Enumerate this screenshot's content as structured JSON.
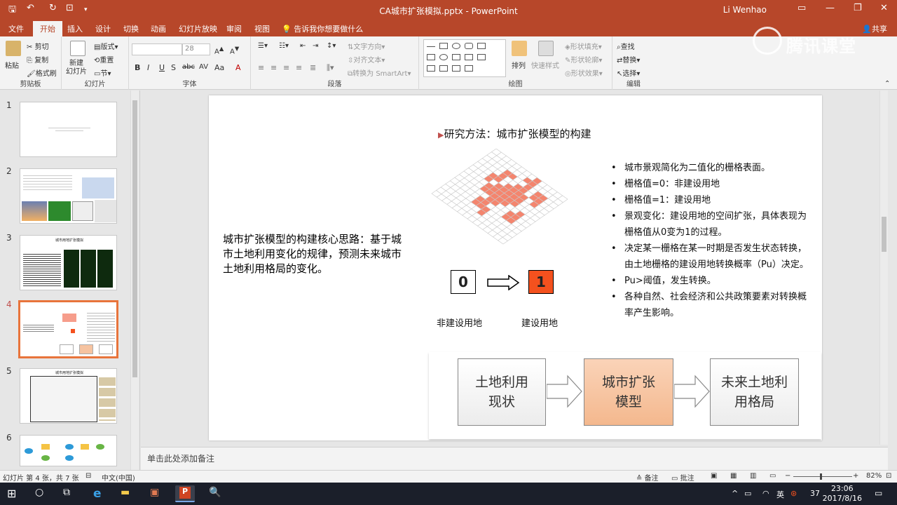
{
  "window": {
    "title": "CA城市扩张模拟.pptx - PowerPoint",
    "user": "Li Wenhao",
    "minimize": "—",
    "restore": "❐",
    "close": "✕"
  },
  "tabs": [
    "文件",
    "开始",
    "插入",
    "设计",
    "切换",
    "动画",
    "幻灯片放映",
    "审阅",
    "视图"
  ],
  "tell_me": "告诉我你想要做什么",
  "share": "共享",
  "watermark": "腾讯课堂",
  "ribbon": {
    "clipboard": {
      "label": "剪贴板",
      "paste": "粘贴",
      "cut": "剪切",
      "copy": "复制",
      "format_painter": "格式刷"
    },
    "slides": {
      "label": "幻灯片",
      "new_slide": "新建\n幻灯片",
      "layout": "版式",
      "reset": "重置",
      "section": "节"
    },
    "font": {
      "label": "字体",
      "font_size": "28",
      "bold": "B",
      "italic": "I",
      "underline": "U",
      "strike": "S",
      "abc": "abc",
      "spacing": "AV",
      "case": "Aa",
      "clear": "A",
      "color": "A"
    },
    "paragraph": {
      "label": "段落",
      "text_direction": "文字方向",
      "align_text": "对齐文本",
      "smartart": "转换为 SmartArt"
    },
    "drawing": {
      "label": "绘图",
      "arrange": "排列",
      "quick_styles": "快速样式",
      "shape_fill": "形状填充",
      "shape_outline": "形状轮廓",
      "shape_effects": "形状效果"
    },
    "editing": {
      "label": "编辑",
      "find": "查找",
      "replace": "替换",
      "select": "选择"
    }
  },
  "thumbnails": [
    {
      "num": "1"
    },
    {
      "num": "2"
    },
    {
      "num": "3",
      "caption": "城市用地扩张模拟"
    },
    {
      "num": "4"
    },
    {
      "num": "5",
      "caption": "城市用地扩张模拟"
    },
    {
      "num": "6"
    }
  ],
  "slide": {
    "heading": "研究方法：城市扩张模型的构建",
    "left_paragraph": "城市扩张模型的构建核心思路：基于城市土地利用变化的规律，预测未来城市土地利用格局的变化。",
    "bullets": [
      "城市景观简化为二值化的栅格表面。",
      "栅格值=0：非建设用地",
      "栅格值=1：建设用地",
      "景观变化：建设用地的空间扩张，具体表现为栅格值从0变为1的过程。",
      "决定某一栅格在某一时期是否发生状态转换，由土地栅格的建设用地转换概率（Pu）决定。",
      "Pu>阈值，发生转换。",
      "各种自然、社会经济和公共政策要素对转换概率产生影响。"
    ],
    "state_zero": "0",
    "state_one": "1",
    "label_zero": "非建设用地",
    "label_one": "建设用地",
    "flow": [
      "土地利用\n现状",
      "城市扩张\n模型",
      "未来土地利\n用格局"
    ]
  },
  "notes_placeholder": "单击此处添加备注",
  "status": {
    "slide_info": "幻灯片 第 4 张，共 7 张",
    "language": "中文(中国)",
    "notes": "备注",
    "comments": "批注",
    "zoom": "82%"
  },
  "taskbar": {
    "time": "23:06",
    "date": "2017/8/16",
    "ime": "英",
    "temp": "37"
  },
  "colors": {
    "accent": "#b7472a",
    "built": "#f4856e",
    "one_box": "#f4511e",
    "flow_mid": "#f6c3a0"
  }
}
